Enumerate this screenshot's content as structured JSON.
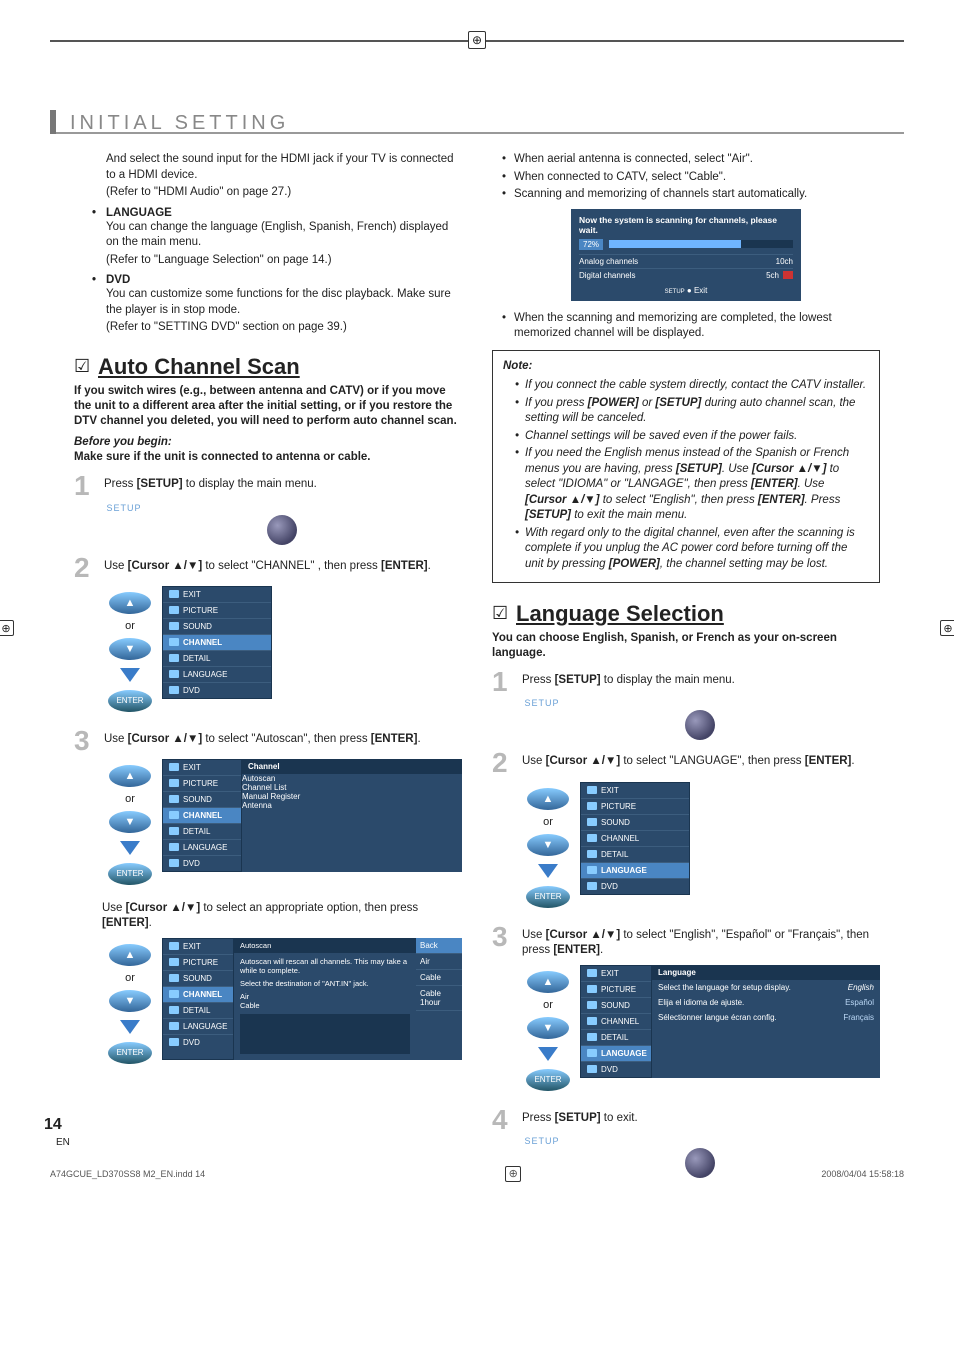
{
  "header": {
    "title": "INITIAL SETTING"
  },
  "left": {
    "intro1": "And select the sound input for the HDMI jack if your TV is connected to a HDMI device.",
    "intro1_ref": "(Refer to \"HDMI Audio\" on page 27.)",
    "lang_label": "LANGUAGE",
    "lang_text": "You can change the language (English, Spanish, French) displayed on the main menu.",
    "lang_ref": "(Refer to \"Language Selection\" on page 14.)",
    "dvd_label": "DVD",
    "dvd_text": "You can customize some functions for the disc playback. Make sure the player is in stop mode.",
    "dvd_ref": "(Refer to \"SETTING DVD\" section on page 39.)",
    "acs_heading": "Auto Channel Scan",
    "acs_intro": "If you switch wires (e.g., between antenna and CATV) or if you move the unit to a different area after the initial setting, or if you restore the DTV channel you deleted, you will need to perform auto channel scan.",
    "before_head": "Before you begin:",
    "before_text": "Make sure if the unit is connected to antenna or cable.",
    "step1": "Press [SETUP] to display the main menu.",
    "step2": "Use [Cursor ▲/▼] to select \"CHANNEL\" , then press [ENTER].",
    "step3": "Use [Cursor ▲/▼] to select \"Autoscan\", then press [ENTER].",
    "step3b": "Use [Cursor ▲/▼] to select an appropriate option, then press [ENTER].",
    "or": "or",
    "setup_label": "SETUP",
    "enter_label": "ENTER",
    "osd_items": [
      "EXIT",
      "PICTURE",
      "SOUND",
      "CHANNEL",
      "DETAIL",
      "LANGUAGE",
      "DVD"
    ],
    "channel_panel_head": "Channel",
    "channel_panel_items": [
      "Autoscan",
      "Channel List",
      "Manual Register",
      "Antenna"
    ],
    "autoscan_head": "Autoscan",
    "autoscan_text1": "Autoscan will rescan all channels. This may take a while to complete.",
    "autoscan_text2": "Select the destination of \"ANT.IN\" jack.",
    "autoscan_opt_air": "Air",
    "autoscan_opt_cable": "Cable",
    "autoscan_opts": [
      "Back",
      "Air",
      "Cable",
      "Cable 1hour"
    ]
  },
  "right": {
    "b1": "When aerial antenna is connected, select \"Air\".",
    "b2": "When connected to CATV, select \"Cable\".",
    "b3": "Scanning and memorizing of channels start automatically.",
    "scan_title": "Now the system is scanning for channels, please wait.",
    "scan_pct": "72%",
    "scan_analog_l": "Analog channels",
    "scan_analog_v": "10ch",
    "scan_digital_l": "Digital channels",
    "scan_digital_v": "5ch",
    "scan_exit": "Exit",
    "scan_exit_pre": "SETUP",
    "post_scan": "When the scanning and memorizing are completed, the lowest memorized channel will be displayed.",
    "note_head": "Note:",
    "n1": "If you connect the cable system directly, contact the CATV installer.",
    "n2": "If you press [POWER] or [SETUP] during auto channel scan, the setting will be canceled.",
    "n3": "Channel settings will be saved even if the power fails.",
    "n4": "If you need the English menus instead of the Spanish or French menus you are having, press [SETUP]. Use [Cursor ▲/▼] to select \"IDIOMA\" or \"LANGAGE\", then press [ENTER]. Use [Cursor ▲/▼] to select \"English\", then press [ENTER]. Press [SETUP] to exit the main menu.",
    "n5": "With regard only to the digital channel, even after the scanning is complete if you unplug the AC power cord before turning off the unit by pressing [POWER], the channel setting may be lost.",
    "ls_heading": "Language Selection",
    "ls_intro": "You can choose English, Spanish, or French as your on-screen language.",
    "ls_step1": "Press [SETUP] to display the main menu.",
    "ls_step2": "Use [Cursor ▲/▼] to select \"LANGUAGE\", then press [ENTER].",
    "ls_step3": "Use [Cursor ▲/▼] to select \"English\", \"Español\" or \"Français\", then press [ENTER].",
    "ls_step4": "Press [SETUP] to exit.",
    "lang_panel_head": "Language",
    "lang_rows": [
      {
        "l": "Select the language for setup display.",
        "v": "English"
      },
      {
        "l": "Elija el idioma de ajuste.",
        "v": "Español"
      },
      {
        "l": "Sélectionner langue écran config.",
        "v": "Français"
      }
    ]
  },
  "footer": {
    "page": "14",
    "lang": "EN",
    "file": "A74GCUE_LD370SS8 M2_EN.indd   14",
    "date": "2008/04/04   15:58:18"
  }
}
